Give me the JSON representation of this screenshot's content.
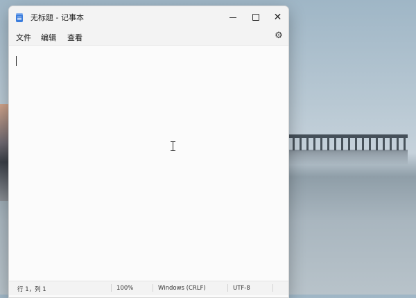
{
  "window": {
    "title": "无标题 - 记事本",
    "close_symbol": "✕"
  },
  "menu": {
    "items": [
      {
        "label": "文件"
      },
      {
        "label": "编辑"
      },
      {
        "label": "查看"
      }
    ],
    "settings_icon_glyph": "⚙"
  },
  "editor": {
    "content": ""
  },
  "status": {
    "position": "行 1，列 1",
    "zoom": "100%",
    "line_ending": "Windows (CRLF)",
    "encoding": "UTF-8"
  },
  "icons": {
    "app": "notepad-icon",
    "minimize": "minimize-icon",
    "maximize": "maximize-icon",
    "close": "close-icon",
    "settings": "gear-icon",
    "pointer": "text-cursor-icon"
  },
  "colors": {
    "window_bg": "#fbfbfb",
    "chrome_bg": "#f3f3f3",
    "accent": "#3b7ddd"
  }
}
